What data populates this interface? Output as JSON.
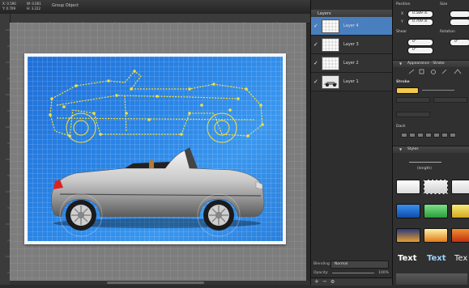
{
  "toolbar": {
    "x_label": "X:",
    "x_value": "0.590",
    "y_label": "Y:",
    "y_value": "0.709",
    "w_label": "W:",
    "w_value": "0.061",
    "h_label": "H:",
    "h_value": "3.222",
    "selection_title": "Group Object",
    "icons": [
      "help-icon",
      "pencil-icon",
      "grid-icon",
      "palette-icon"
    ]
  },
  "layers": {
    "header": "Layers",
    "items": [
      {
        "name": "Layer 4",
        "checked": "✓",
        "selected": true
      },
      {
        "name": "Layer 3",
        "checked": "✓",
        "selected": false
      },
      {
        "name": "Layer 2",
        "checked": "✓",
        "selected": false
      },
      {
        "name": "Layer 1",
        "checked": "✓",
        "selected": false
      }
    ],
    "blending_label": "Blending:",
    "blending_value": "Normal",
    "opacity_label": "Opacity:",
    "opacity_value": "100%"
  },
  "inspector": {
    "position_label": "Position",
    "size_label": "Size",
    "x_label": "X",
    "x_value": "0.589 in",
    "y_label": "Y",
    "y_value": "0.709 in",
    "shear_label": "Shear",
    "rotation_label": "Rotation",
    "shear_value": "0°",
    "rotation_value": "0°",
    "shear_value2": "0°",
    "appearance_header": "Appearance · Stroke",
    "stroke_label": "Stroke",
    "stroke_color": "#f2c94c",
    "dash_label": "Dash",
    "styles_header": "Styles",
    "length_label": "(length)",
    "text_styles": [
      "Text",
      "Text",
      "Tex"
    ]
  }
}
